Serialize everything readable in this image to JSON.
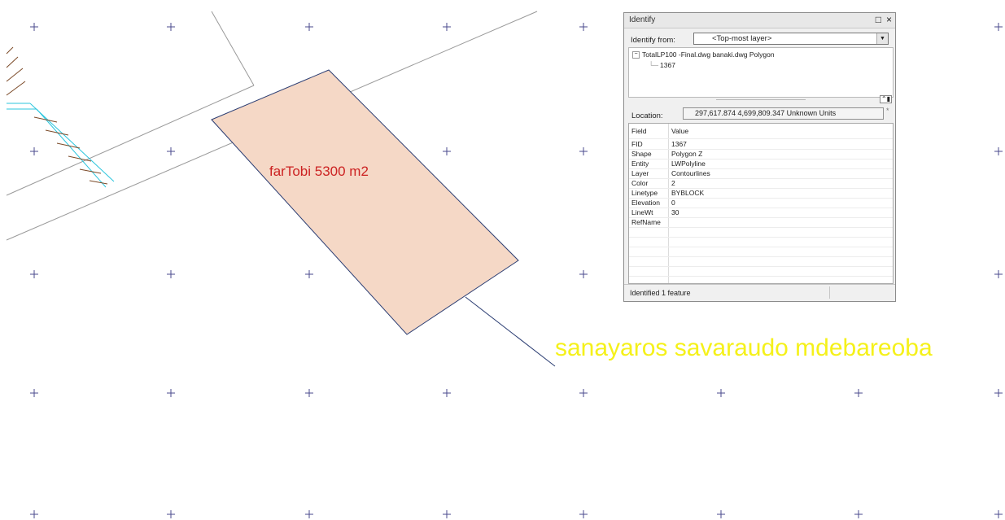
{
  "colors": {
    "background": "#ffffff",
    "grid_cross": "#4a4a8c",
    "parcel_fill": "#f5d8c6",
    "parcel_stroke": "#2c3e73",
    "line_gray": "#9a9a9a",
    "hatch_cyan": "#2bc5dd",
    "hatch_brown": "#7b4a28",
    "parcel_label": "#cc2222",
    "annotation_label": "#f5f11a"
  },
  "map": {
    "parcel_label": "farTobi 5300 m2",
    "annotation_label": "sanayaros savaraudo mdebareoba"
  },
  "identify": {
    "title": "Identify",
    "restore_icon": "restore-icon",
    "close_icon": "close-icon",
    "identify_from_label": "Identify from:",
    "identify_from_value": "<Top-most layer>",
    "tree": {
      "layer": "TotalLP100 -Final.dwg banaki.dwg Polygon",
      "feature": "1367"
    },
    "location_label": "Location:",
    "location_value": "297,617.874  4,699,809.347 Unknown Units",
    "table": {
      "header": [
        "Field",
        "Value"
      ],
      "rows": [
        [
          "FID",
          "1367"
        ],
        [
          "Shape",
          "Polygon Z"
        ],
        [
          "Entity",
          "LWPolyline"
        ],
        [
          "Layer",
          "Contourlines"
        ],
        [
          "Color",
          "2"
        ],
        [
          "Linetype",
          "BYBLOCK"
        ],
        [
          "Elevation",
          "0"
        ],
        [
          "LineWt",
          "30"
        ],
        [
          "RefName",
          ""
        ]
      ]
    },
    "status": "Identified 1 feature"
  }
}
